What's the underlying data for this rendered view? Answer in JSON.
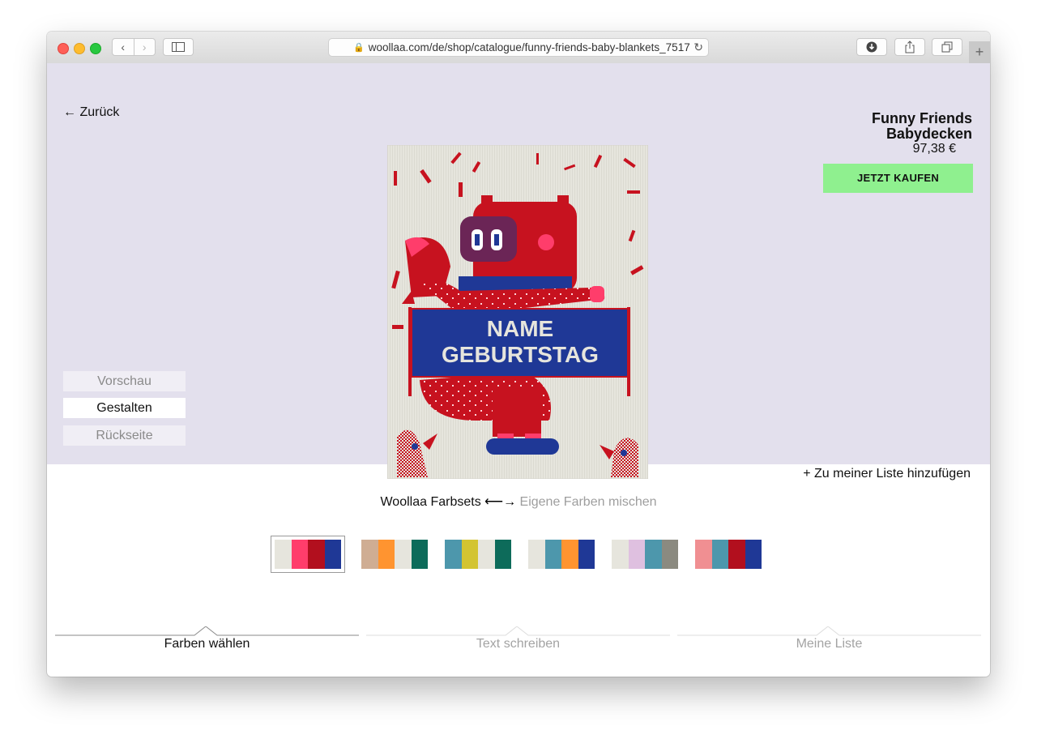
{
  "browser": {
    "url": "woollaa.com/de/shop/catalogue/funny-friends-baby-blankets_7517",
    "new_tab": "+"
  },
  "nav": {
    "back_label": "← Zurück"
  },
  "product": {
    "title_line1": "Funny Friends",
    "title_line2": "Babydecken",
    "price": "97,38 €",
    "buy_label": "JETZT KAUFEN",
    "add_to_list": "+ Zu meiner Liste hinzufügen"
  },
  "view_tabs": [
    {
      "label": "Vorschau",
      "active": false
    },
    {
      "label": "Gestalten",
      "active": true
    },
    {
      "label": "Rückseite",
      "active": false
    }
  ],
  "blanket": {
    "banner_line1": "NAME",
    "banner_line2": "GEBURTSTAG"
  },
  "colorsets": {
    "active_label": "Woollaa Farbsets",
    "arrow": "⟵→",
    "inactive_label": "Eigene Farben mischen",
    "palettes": [
      {
        "colors": [
          "#e6e5dd",
          "#ff3d6b",
          "#b20f1e",
          "#1f3896"
        ],
        "selected": true
      },
      {
        "colors": [
          "#cfad93",
          "#ff9430",
          "#e6e5dd",
          "#0d6b5a"
        ],
        "selected": false
      },
      {
        "colors": [
          "#4d97ac",
          "#d3c431",
          "#e6e5dd",
          "#0d6b5a"
        ],
        "selected": false
      },
      {
        "colors": [
          "#e6e5dd",
          "#4d97ac",
          "#ff9430",
          "#1f3896"
        ],
        "selected": false
      },
      {
        "colors": [
          "#e6e5dd",
          "#dfc0e0",
          "#4d97ac",
          "#8b8a80"
        ],
        "selected": false
      },
      {
        "colors": [
          "#f08f92",
          "#4d97ac",
          "#b20f1e",
          "#1f3896"
        ],
        "selected": false
      }
    ]
  },
  "steps": [
    {
      "label": "Farben wählen",
      "active": true
    },
    {
      "label": "Text schreiben",
      "active": false
    },
    {
      "label": "Meine Liste",
      "active": false
    }
  ],
  "colors": {
    "hero_bg": "#e3e0ed",
    "buy_bg": "#8ff08f",
    "blanket_red": "#c7121f",
    "blanket_blue": "#1f3896",
    "blanket_bg": "#e6e5dd",
    "blanket_purple": "#6b2556",
    "blanket_pink": "#ff3d6b"
  }
}
